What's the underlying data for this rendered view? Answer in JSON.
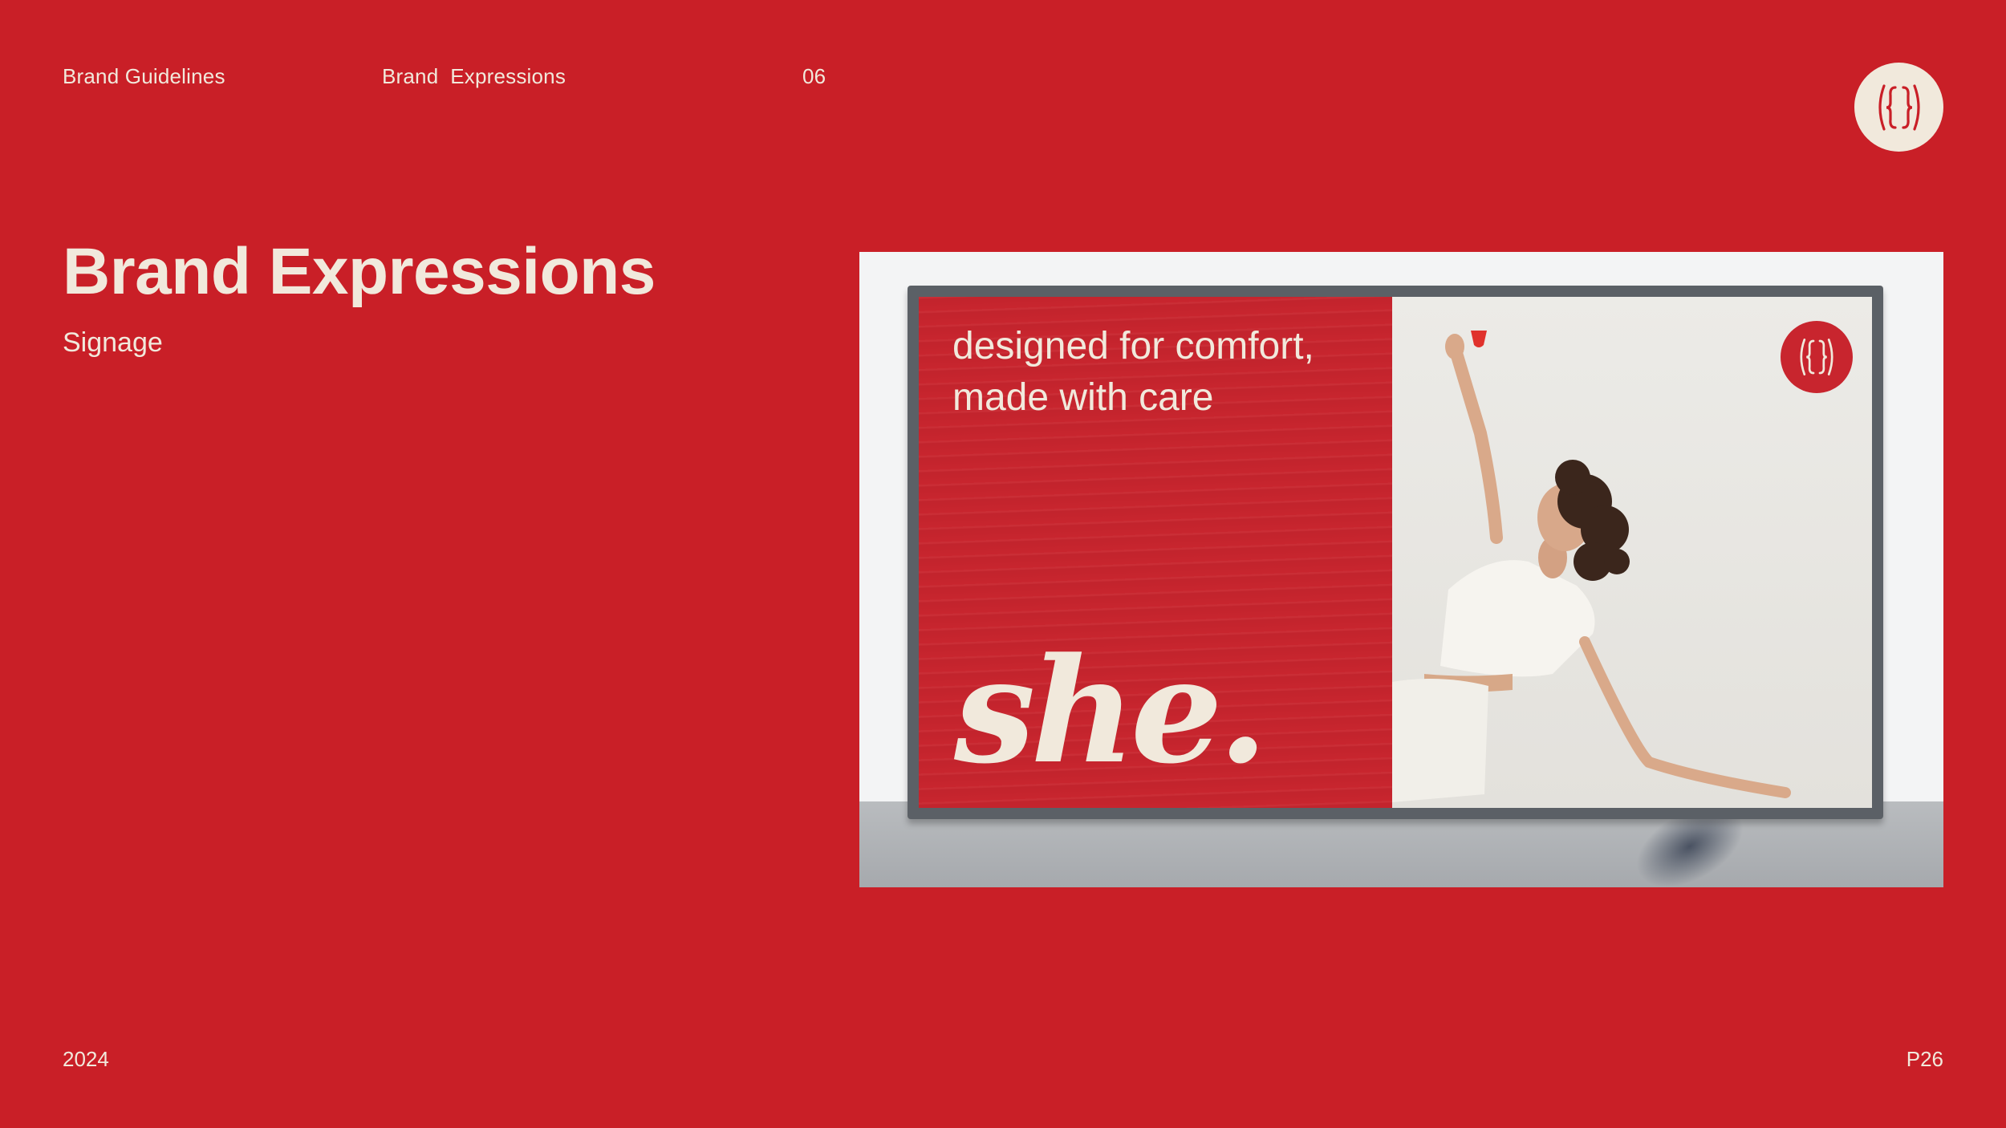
{
  "header": {
    "section_label": "Brand Guidelines",
    "chapter_label": "Brand  Expressions",
    "chapter_number": "06"
  },
  "logo": {
    "icon": "brace-mark-icon"
  },
  "main": {
    "title": "Brand Expressions",
    "subtitle": "Signage"
  },
  "photo": {
    "tagline_lines": [
      "designed for comfort,",
      "made with care"
    ],
    "brand_wordmark": "she.",
    "icons": [
      "brace-mark-icon",
      "menstrual-cup-icon"
    ]
  },
  "footer": {
    "year": "2024",
    "page": "P26"
  },
  "colors": {
    "background": "#c91f27",
    "text": "#f1e9dc",
    "poster_red": "#c8252e",
    "logo_bg": "#f1e9dc"
  }
}
